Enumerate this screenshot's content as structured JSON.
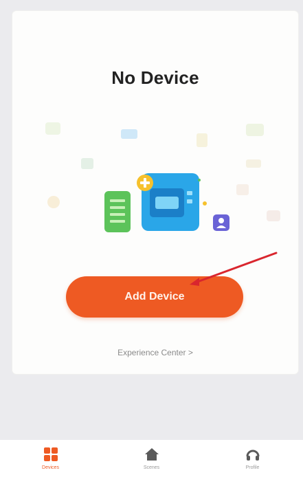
{
  "empty_state": {
    "title": "No Device",
    "add_button": "Add Device",
    "experience_link": "Experience Center >"
  },
  "tabs": [
    {
      "label": "Devices",
      "icon": "grid-icon",
      "active": true
    },
    {
      "label": "Scenes",
      "icon": "home-icon",
      "active": false
    },
    {
      "label": "Profile",
      "icon": "headset-icon",
      "active": false
    }
  ],
  "colors": {
    "accent": "#ee5a23",
    "device_blue": "#2aa6e8",
    "device_green": "#5cc35a",
    "badge_yellow": "#f6c12c",
    "badge_purple": "#6a63d6",
    "annotation_arrow": "#d9262e"
  }
}
